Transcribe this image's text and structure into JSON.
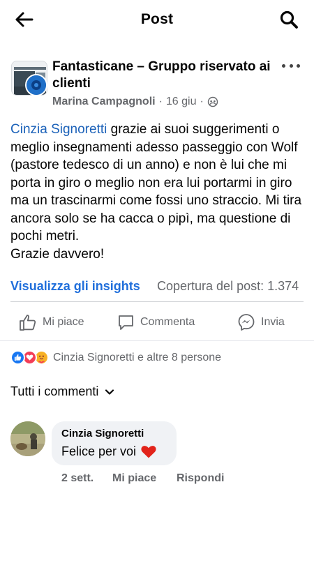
{
  "header": {
    "title": "Post",
    "back_icon": "arrow-left-icon",
    "search_icon": "search-icon"
  },
  "post": {
    "group_name": "Fantasticane – Gruppo riservato ai clienti",
    "author": "Marina Campagnoli",
    "date": "16 giu",
    "separator": "·",
    "privacy_icon": "members-icon",
    "mention": "Cinzia Signoretti",
    "body": " grazie ai suoi suggerimenti o meglio insegnamenti adesso passeggio con Wolf (pastore tedesco di un anno) e non è lui che mi porta in giro o meglio non era lui portarmi in giro ma un trascinarmi come fossi uno straccio. Mi tira ancora solo se ha cacca o pipì, ma questione di pochi metri.",
    "body_last": "Grazie davvero!",
    "insights_label": "Visualizza gli insights",
    "reach_label": "Copertura del post: 1.374"
  },
  "actions": {
    "like": "Mi piace",
    "comment": "Commenta",
    "share": "Invia"
  },
  "reactions": {
    "summary": "Cinzia Signoretti e altre 8 persone",
    "icons": [
      "like-reaction-icon",
      "love-reaction-icon",
      "care-reaction-icon"
    ],
    "colors": {
      "like": "#1877f2",
      "love": "#f33e58",
      "care": "#f7b125"
    }
  },
  "comments": {
    "filter_label": "Tutti i commenti",
    "items": [
      {
        "author": "Cinzia Signoretti",
        "text": "Felice per voi",
        "time": "2 sett.",
        "like": "Mi piace",
        "reply": "Rispondi"
      }
    ]
  },
  "colors": {
    "link": "#216fdb",
    "mention": "#1c62b9",
    "secondary_text": "#65676b",
    "divider": "#ced0d4"
  }
}
